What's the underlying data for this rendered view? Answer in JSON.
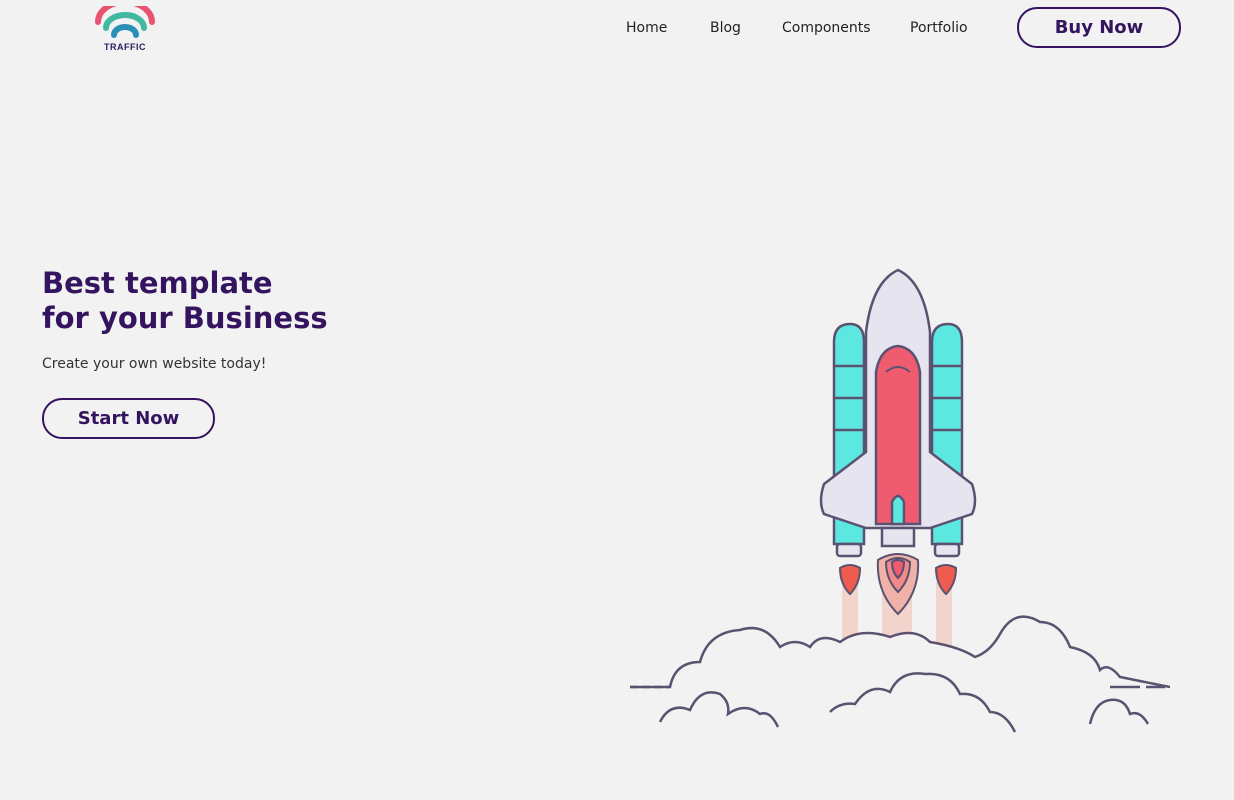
{
  "header": {
    "logo_text": "TRAFFIC",
    "nav": [
      {
        "label": "Home"
      },
      {
        "label": "Blog"
      },
      {
        "label": "Components"
      },
      {
        "label": "Portfolio"
      }
    ],
    "buy_label": "Buy Now"
  },
  "hero": {
    "title_line1": "Best template",
    "title_line2": "for your Business",
    "subtitle": "Create your own website today!",
    "cta_label": "Start Now"
  },
  "colors": {
    "background": "#f2f2f2",
    "brand": "#34145f",
    "logo_pink": "#e8546f",
    "logo_teal": "#3fb9a0",
    "logo_blue": "#2a8fb7",
    "rocket_body": "#e6e4ef",
    "rocket_booster": "#5ce8e0",
    "rocket_red": "#ef5c6f",
    "outline": "#5a5270"
  },
  "icons": {
    "logo": "traffic-rainbow-logo-icon",
    "illustration": "rocket-launch-icon"
  }
}
